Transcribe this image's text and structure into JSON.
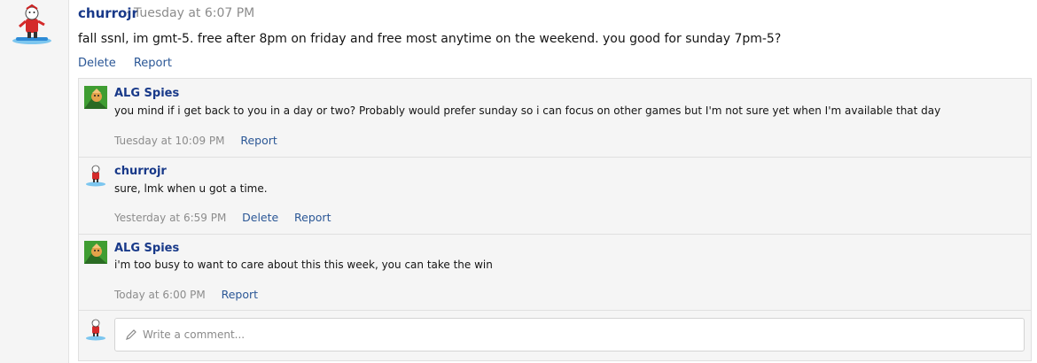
{
  "post": {
    "author": "churrojr",
    "separator": "·",
    "time": "Tuesday at 6:07 PM",
    "body": "fall ssnl, im gmt-5. free after 8pm on friday and free most anytime on the weekend. you good for sunday 7pm-5?",
    "actions": {
      "delete": "Delete",
      "report": "Report"
    }
  },
  "comments": [
    {
      "author": "ALG Spies",
      "body": "you mind if i get back to you in a day or two? Probably would prefer sunday so i can focus on other games but I'm not sure yet when I'm available that day",
      "time": "Tuesday at 10:09 PM",
      "actions": {
        "report": "Report"
      }
    },
    {
      "author": "churrojr",
      "body": "sure, lmk when u got a time.",
      "time": "Yesterday at 6:59 PM",
      "actions": {
        "delete": "Delete",
        "report": "Report"
      }
    },
    {
      "author": "ALG Spies",
      "body": "i'm too busy to want to care about this this week, you can take the win",
      "time": "Today at 6:00 PM",
      "actions": {
        "report": "Report"
      }
    }
  ],
  "composer": {
    "placeholder": "Write a comment..."
  },
  "icons": {
    "avatar_main": "snowboarder-avatar-icon",
    "avatar_alg": "alg-spies-avatar-icon",
    "pencil": "pencil-icon"
  },
  "colors": {
    "link": "#2b5796",
    "author": "#183989",
    "muted": "#8c8c8c",
    "panel": "#f5f5f5"
  }
}
